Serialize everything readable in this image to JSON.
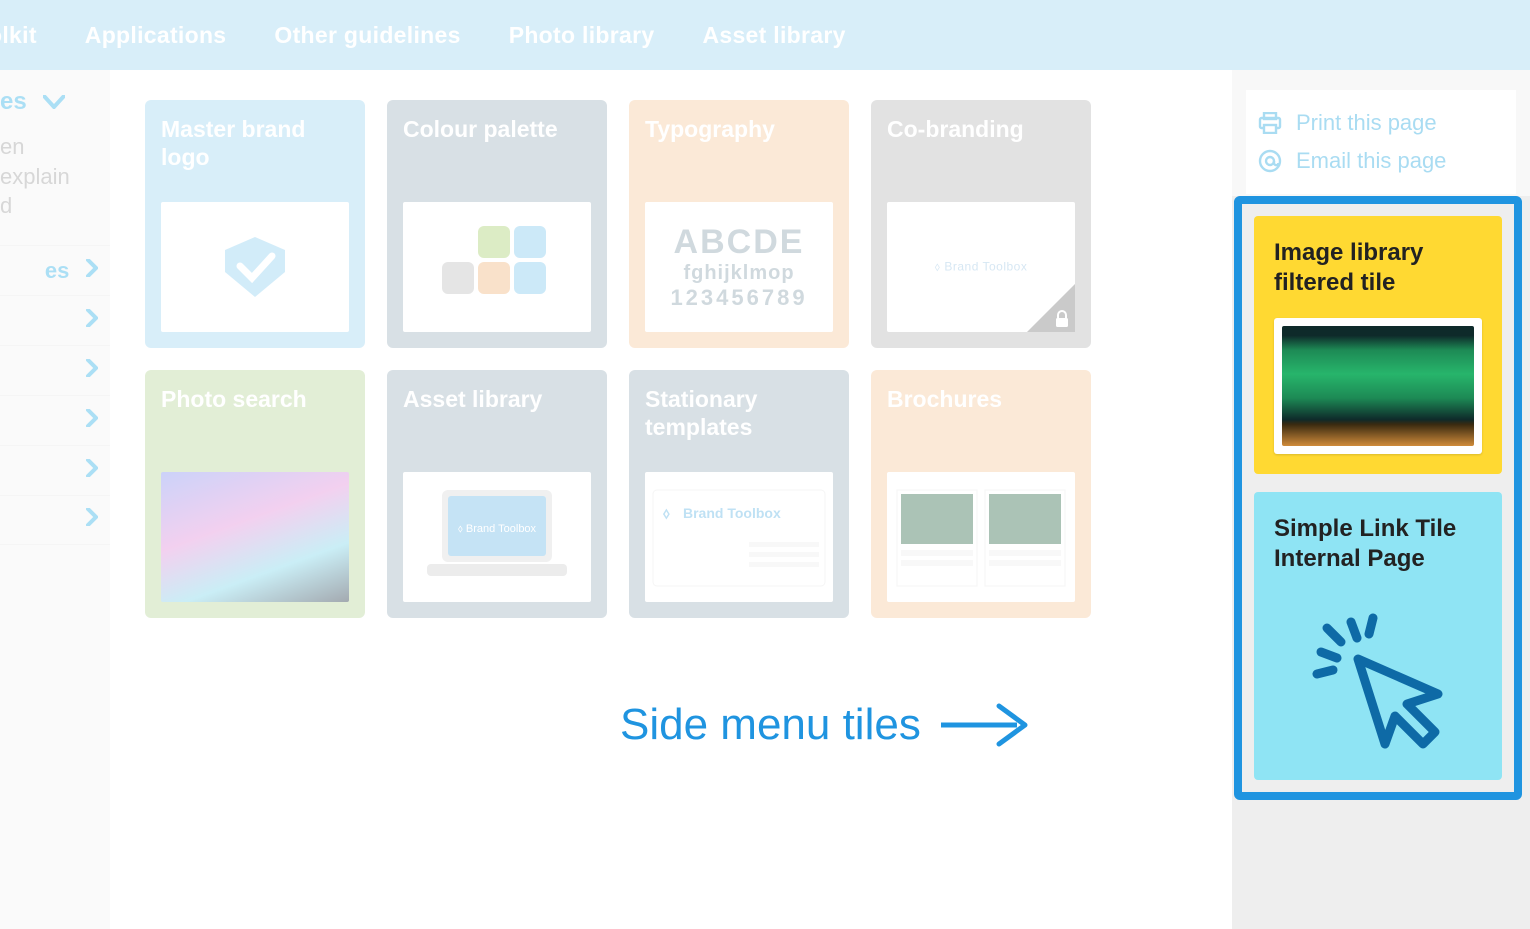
{
  "nav": {
    "items": [
      "olkit",
      "Applications",
      "Other guidelines",
      "Photo library",
      "Asset library"
    ]
  },
  "sidebar": {
    "top_label": "es",
    "muted_lines": [
      "en",
      "explain",
      "d"
    ],
    "link_label": "es",
    "row_count": 5
  },
  "tiles": [
    {
      "title": "Master brand logo",
      "color": "t-blue",
      "kind": "logo"
    },
    {
      "title": "Colour palette",
      "color": "t-slate",
      "kind": "palette"
    },
    {
      "title": "Typography",
      "color": "t-peach",
      "kind": "typo"
    },
    {
      "title": "Co-branding",
      "color": "t-grey",
      "kind": "co"
    },
    {
      "title": "Photo search",
      "color": "t-green",
      "kind": "aurora"
    },
    {
      "title": "Asset library",
      "color": "t-slate",
      "kind": "laptop"
    },
    {
      "title": "Stationary templates",
      "color": "t-slate",
      "kind": "card"
    },
    {
      "title": "Brochures",
      "color": "t-peach",
      "kind": "brochure"
    }
  ],
  "typography_sample": {
    "l1": "ABCDE",
    "l2": "fghijklmop",
    "l3": "123456789"
  },
  "utility": {
    "print": "Print this page",
    "email": "Email this page"
  },
  "side_tiles": {
    "a_title": "Image library filtered tile",
    "b_title": "Simple Link Tile Internal Page"
  },
  "callout": "Side menu tiles",
  "co_brand_text": "Brand Toolbox",
  "card_text": "Brand Toolbox",
  "laptop_text": "Brand Toolbox"
}
